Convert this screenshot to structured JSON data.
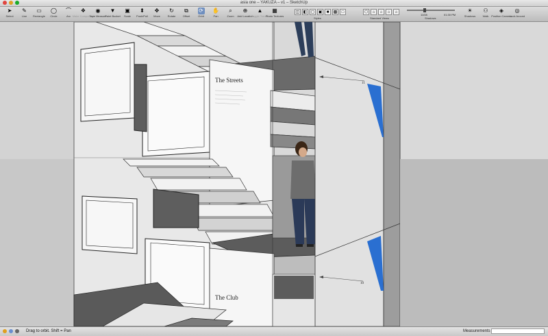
{
  "window": {
    "title": "asia one – YAKUZA – v1 – SketchUp"
  },
  "toolbar": {
    "tools": [
      {
        "name": "select",
        "label": "Select",
        "icon": "arrow-icon",
        "glyph": "➤"
      },
      {
        "name": "line",
        "label": "Line",
        "icon": "pencil-icon",
        "glyph": "✎"
      },
      {
        "name": "rectangle",
        "label": "Rectangle",
        "icon": "rectangle-icon",
        "glyph": "▭"
      },
      {
        "name": "circle",
        "label": "Circle",
        "icon": "circle-icon",
        "glyph": "◯"
      },
      {
        "name": "arc",
        "label": "Arc",
        "icon": "arc-icon",
        "glyph": "⌒"
      },
      {
        "name": "make-component",
        "label": "Make Component",
        "icon": "component-icon",
        "glyph": "❖",
        "disabled": true
      },
      {
        "name": "tape-measure",
        "label": "Tape Measure",
        "icon": "tape-icon",
        "glyph": "◉"
      },
      {
        "name": "paint-bucket",
        "label": "Paint Bucket",
        "icon": "bucket-icon",
        "glyph": "▼"
      },
      {
        "name": "scale",
        "label": "Scale",
        "icon": "scale-icon",
        "glyph": "▣"
      },
      {
        "name": "push-pull",
        "label": "Push/Pull",
        "icon": "pushpull-icon",
        "glyph": "⬍"
      },
      {
        "name": "move",
        "label": "Move",
        "icon": "move-icon",
        "glyph": "✥"
      },
      {
        "name": "rotate",
        "label": "Rotate",
        "icon": "rotate-icon",
        "glyph": "↻"
      },
      {
        "name": "offset",
        "label": "Offset",
        "icon": "offset-icon",
        "glyph": "⧉"
      },
      {
        "name": "orbit",
        "label": "Orbit",
        "icon": "orbit-icon",
        "glyph": "⟳",
        "active": true
      },
      {
        "name": "pan",
        "label": "Pan",
        "icon": "hand-icon",
        "glyph": "✋"
      },
      {
        "name": "zoom",
        "label": "Zoom",
        "icon": "magnifier-icon",
        "glyph": "⌕"
      },
      {
        "name": "add-location",
        "label": "Add Location",
        "icon": "globe-icon",
        "glyph": "⊕"
      },
      {
        "name": "toggle-terrain",
        "label": "Toggle Terrain",
        "icon": "terrain-icon",
        "glyph": "▲",
        "disabled": true
      },
      {
        "name": "photo-textures",
        "label": "Photo Textures",
        "icon": "photo-icon",
        "glyph": "▦"
      }
    ],
    "styles_label": "Styles",
    "standard_views_label": "Standard Views",
    "shadows": {
      "label": "Shadows",
      "date": "11/08",
      "time": "01:30 PM"
    },
    "right_tools": [
      {
        "name": "shadows",
        "label": "Shadows",
        "icon": "sun-icon",
        "glyph": "☀"
      },
      {
        "name": "walk",
        "label": "Walk",
        "icon": "walk-icon",
        "glyph": "⚇"
      },
      {
        "name": "position-camera",
        "label": "Position Camera",
        "icon": "camera-icon",
        "glyph": "◈"
      },
      {
        "name": "look-around",
        "label": "Look Around",
        "icon": "eye-icon",
        "glyph": "◎"
      }
    ]
  },
  "scene": {
    "sign_streets": "The Streets",
    "sign_club": "The Club",
    "dim_upper": "11",
    "dim_lower": "10",
    "colors": {
      "sky": "#d8d8d8",
      "wall": "#efefef",
      "wall_shadow": "#cfcfcf",
      "dark_face": "#5a5a5a",
      "accent_blue": "#2a6fd1"
    }
  },
  "statusbar": {
    "hint": "Drag to orbit.  Shift = Pan",
    "measurements_label": "Measurements",
    "measurements_value": ""
  }
}
